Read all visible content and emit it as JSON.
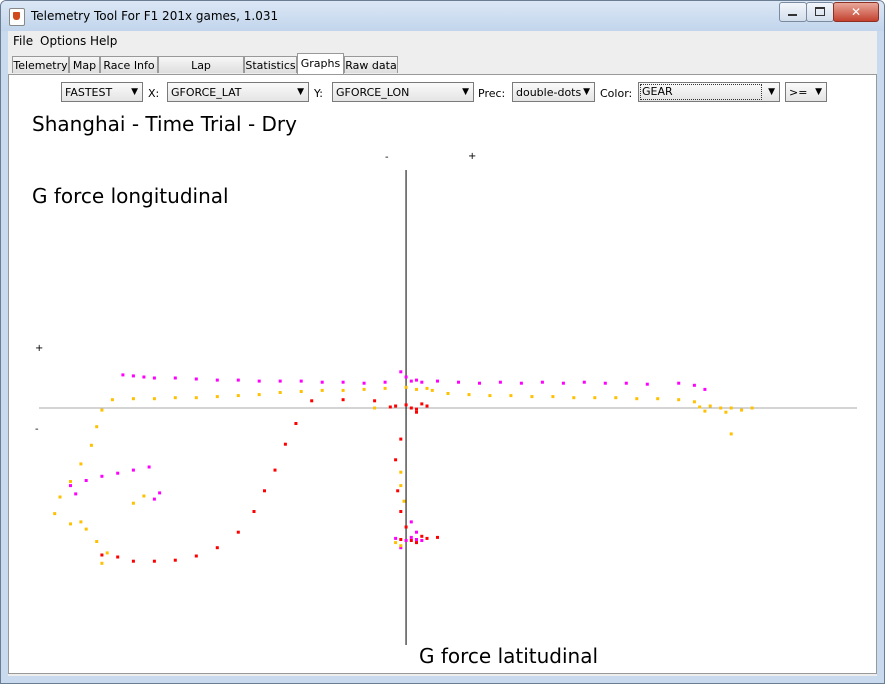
{
  "window": {
    "title": "Telemetry Tool For F1 201x games, 1.031",
    "close_glyph": "✕"
  },
  "menu": [
    "File",
    "Options",
    "Help"
  ],
  "tabs": [
    "Telemetry",
    "Map",
    "Race Info",
    "Lap comparison",
    "Statistics",
    "Graphs",
    "Raw data"
  ],
  "active_tab": "Graphs",
  "controls": {
    "lap_select": "FASTEST",
    "x_label": "X:",
    "x_select": "GFORCE_LAT",
    "y_label": "Y:",
    "y_select": "GFORCE_LON",
    "prec_label": "Prec:",
    "prec_select": "double-dots",
    "color_label": "Color:",
    "color_select": "GEAR",
    "op_select": ">="
  },
  "colors": {
    "gear_a": "#ff00ff",
    "gear_b": "#ffc000",
    "gear_c": "#ff0000",
    "axis": "#000000"
  },
  "chart_data": {
    "type": "scatter",
    "title": "Shanghai - Time Trial - Dry",
    "xlabel": "G force latitudinal",
    "ylabel": "G force longitudinal",
    "x_markers": {
      "negative": "-",
      "positive": "+"
    },
    "y_markers": {
      "positive": "+",
      "negative": "-"
    },
    "xlim": [
      -3.5,
      4.3
    ],
    "ylim": [
      -2.0,
      2.3
    ],
    "series": [
      {
        "color": "#ff00ff",
        "points": [
          [
            -2.7,
            0.32
          ],
          [
            -2.6,
            0.31
          ],
          [
            -2.5,
            0.3
          ],
          [
            -2.4,
            0.29
          ],
          [
            -2.2,
            0.29
          ],
          [
            -2.0,
            0.28
          ],
          [
            -1.8,
            0.27
          ],
          [
            -1.6,
            0.27
          ],
          [
            -1.4,
            0.26
          ],
          [
            -1.2,
            0.26
          ],
          [
            -1.0,
            0.26
          ],
          [
            -0.8,
            0.25
          ],
          [
            -0.6,
            0.25
          ],
          [
            -0.4,
            0.24
          ],
          [
            -0.2,
            0.25
          ],
          [
            0.0,
            0.3
          ],
          [
            0.05,
            0.26
          ],
          [
            0.1,
            0.27
          ],
          [
            0.15,
            0.25
          ],
          [
            -0.05,
            0.35
          ],
          [
            0.3,
            0.26
          ],
          [
            0.5,
            0.25
          ],
          [
            0.7,
            0.24
          ],
          [
            0.9,
            0.25
          ],
          [
            1.1,
            0.24
          ],
          [
            1.3,
            0.25
          ],
          [
            1.5,
            0.24
          ],
          [
            1.7,
            0.25
          ],
          [
            1.9,
            0.24
          ],
          [
            2.1,
            0.24
          ],
          [
            2.3,
            0.23
          ],
          [
            2.6,
            0.24
          ],
          [
            2.75,
            0.22
          ],
          [
            2.85,
            0.18
          ],
          [
            -3.2,
            -0.75
          ],
          [
            -3.05,
            -0.7
          ],
          [
            -2.9,
            -0.66
          ],
          [
            -2.75,
            -0.63
          ],
          [
            -2.6,
            -0.6
          ],
          [
            -2.45,
            -0.57
          ],
          [
            -2.35,
            -0.82
          ],
          [
            -2.4,
            -0.88
          ],
          [
            -3.15,
            -0.83
          ],
          [
            0.05,
            -1.25
          ],
          [
            0.1,
            -1.27
          ],
          [
            0.15,
            -1.28
          ],
          [
            0.0,
            -1.28
          ],
          [
            -0.1,
            -1.26
          ],
          [
            0.1,
            -1.2
          ],
          [
            0.05,
            -1.1
          ],
          [
            -0.05,
            -1.35
          ]
        ]
      },
      {
        "color": "#ffc000",
        "points": [
          [
            -2.8,
            0.08
          ],
          [
            -2.6,
            0.09
          ],
          [
            -2.4,
            0.09
          ],
          [
            -2.2,
            0.1
          ],
          [
            -2.0,
            0.1
          ],
          [
            -1.8,
            0.11
          ],
          [
            -1.6,
            0.12
          ],
          [
            -1.4,
            0.13
          ],
          [
            -1.2,
            0.15
          ],
          [
            -1.0,
            0.16
          ],
          [
            -0.8,
            0.17
          ],
          [
            -0.6,
            0.17
          ],
          [
            -0.4,
            0.18
          ],
          [
            -0.2,
            0.19
          ],
          [
            0.0,
            0.2
          ],
          [
            0.1,
            0.18
          ],
          [
            0.2,
            0.19
          ],
          [
            0.25,
            0.17
          ],
          [
            0.4,
            0.14
          ],
          [
            0.6,
            0.13
          ],
          [
            0.8,
            0.12
          ],
          [
            1.0,
            0.12
          ],
          [
            1.2,
            0.11
          ],
          [
            1.4,
            0.11
          ],
          [
            1.6,
            0.1
          ],
          [
            1.8,
            0.1
          ],
          [
            2.0,
            0.1
          ],
          [
            2.2,
            0.09
          ],
          [
            2.4,
            0.09
          ],
          [
            2.6,
            0.08
          ],
          [
            2.75,
            0.06
          ],
          [
            2.8,
            0.01
          ],
          [
            2.9,
            0.02
          ],
          [
            3.0,
            0.0
          ],
          [
            3.1,
            0.0
          ],
          [
            3.2,
            -0.02
          ],
          [
            3.3,
            0.0
          ],
          [
            2.85,
            -0.03
          ],
          [
            3.05,
            -0.04
          ],
          [
            3.1,
            -0.25
          ],
          [
            -2.9,
            -0.02
          ],
          [
            -2.95,
            -0.18
          ],
          [
            -3.0,
            -0.36
          ],
          [
            -3.1,
            -0.54
          ],
          [
            -3.2,
            -0.71
          ],
          [
            -3.3,
            -0.86
          ],
          [
            -3.35,
            -1.02
          ],
          [
            -3.2,
            -1.12
          ],
          [
            -3.05,
            -1.17
          ],
          [
            -2.95,
            -1.29
          ],
          [
            -2.85,
            -1.4
          ],
          [
            -2.9,
            -1.5
          ],
          [
            -3.1,
            -1.1
          ],
          [
            -2.5,
            -0.85
          ],
          [
            -2.6,
            -0.92
          ],
          [
            -0.05,
            -0.62
          ],
          [
            -0.1,
            -1.3
          ],
          [
            -0.05,
            -1.33
          ],
          [
            0.1,
            -1.3
          ],
          [
            -0.3,
            -0.0
          ],
          [
            -0.05,
            -0.75
          ],
          [
            -0.02,
            -0.9
          ]
        ]
      },
      {
        "color": "#ff0000",
        "points": [
          [
            -2.9,
            -1.42
          ],
          [
            -2.75,
            -1.44
          ],
          [
            -2.6,
            -1.48
          ],
          [
            -2.4,
            -1.48
          ],
          [
            -2.2,
            -1.47
          ],
          [
            -2.0,
            -1.43
          ],
          [
            -1.8,
            -1.35
          ],
          [
            -1.6,
            -1.2
          ],
          [
            -1.45,
            -1.0
          ],
          [
            -1.35,
            -0.8
          ],
          [
            -1.25,
            -0.6
          ],
          [
            -1.15,
            -0.35
          ],
          [
            -1.05,
            -0.15
          ],
          [
            -0.9,
            0.07
          ],
          [
            -0.6,
            0.08
          ],
          [
            -0.3,
            0.07
          ],
          [
            -0.1,
            0.02
          ],
          [
            0.0,
            0.03
          ],
          [
            0.05,
            0.0
          ],
          [
            0.1,
            -0.01
          ],
          [
            0.15,
            0.04
          ],
          [
            0.2,
            0.02
          ],
          [
            -0.15,
            0.01
          ],
          [
            0.1,
            -0.04
          ],
          [
            -0.05,
            -0.3
          ],
          [
            -0.1,
            -0.5
          ],
          [
            -0.08,
            -0.8
          ],
          [
            -0.05,
            -1.0
          ],
          [
            0.0,
            -1.15
          ],
          [
            0.05,
            -1.28
          ],
          [
            0.1,
            -1.3
          ],
          [
            0.2,
            -1.26
          ],
          [
            0.3,
            -1.25
          ],
          [
            0.15,
            -1.24
          ],
          [
            -0.05,
            -1.27
          ]
        ]
      }
    ]
  }
}
